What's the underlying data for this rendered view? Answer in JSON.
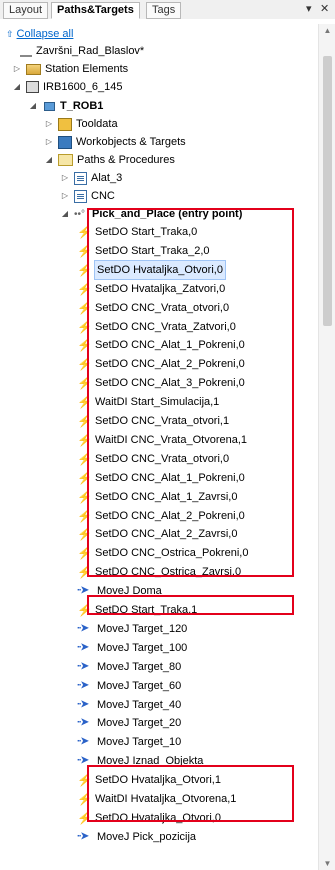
{
  "tabs": [
    "Layout",
    "Paths&Targets",
    "Tags"
  ],
  "tab_controls": {
    "dropdown": "▾",
    "close": "✕"
  },
  "collapse_all": "Collapse all",
  "tree": {
    "station": "Završni_Rad_Blaslov*",
    "station_elements": "Station Elements",
    "robot": "IRB1600_6_145",
    "task": "T_ROB1",
    "tooldata": "Tooldata",
    "workobjects": "Workobjects & Targets",
    "paths_procedures": "Paths & Procedures",
    "module_alat3": "Alat_3",
    "module_cnc": "CNC",
    "procedure": "Pick_and_Place (entry point)"
  },
  "instructions": [
    {
      "text": "SetDO Start_Traka,0",
      "kind": "io"
    },
    {
      "text": "SetDO Start_Traka_2,0",
      "kind": "io"
    },
    {
      "text": "SetDO Hvataljka_Otvori,0",
      "kind": "io",
      "selected": true
    },
    {
      "text": "SetDO Hvataljka_Zatvori,0",
      "kind": "io"
    },
    {
      "text": "SetDO CNC_Vrata_otvori,0",
      "kind": "io"
    },
    {
      "text": "SetDO CNC_Vrata_Zatvori,0",
      "kind": "io"
    },
    {
      "text": "SetDO CNC_Alat_1_Pokreni,0",
      "kind": "io"
    },
    {
      "text": "SetDO CNC_Alat_2_Pokreni,0",
      "kind": "io"
    },
    {
      "text": "SetDO CNC_Alat_3_Pokreni,0",
      "kind": "io"
    },
    {
      "text": "WaitDI Start_Simulacija,1",
      "kind": "io"
    },
    {
      "text": "SetDO CNC_Vrata_otvori,1",
      "kind": "io"
    },
    {
      "text": "WaitDI CNC_Vrata_Otvorena,1",
      "kind": "io"
    },
    {
      "text": "SetDO CNC_Vrata_otvori,0",
      "kind": "io"
    },
    {
      "text": "SetDO CNC_Alat_1_Pokreni,0",
      "kind": "io"
    },
    {
      "text": "SetDO CNC_Alat_1_Zavrsi,0",
      "kind": "io"
    },
    {
      "text": "SetDO CNC_Alat_2_Pokreni,0",
      "kind": "io"
    },
    {
      "text": "SetDO CNC_Alat_2_Zavrsi,0",
      "kind": "io"
    },
    {
      "text": "SetDO CNC_Ostrica_Pokreni,0",
      "kind": "io"
    },
    {
      "text": "SetDO CNC_Ostrica_Zavrsi,0",
      "kind": "io"
    },
    {
      "text": "MoveJ Doma",
      "kind": "move"
    },
    {
      "text": "SetDO Start_Traka,1",
      "kind": "io"
    },
    {
      "text": "MoveJ Target_120",
      "kind": "move"
    },
    {
      "text": "MoveJ Target_100",
      "kind": "move"
    },
    {
      "text": "MoveJ Target_80",
      "kind": "move"
    },
    {
      "text": "MoveJ Target_60",
      "kind": "move"
    },
    {
      "text": "MoveJ Target_40",
      "kind": "move"
    },
    {
      "text": "MoveJ Target_20",
      "kind": "move"
    },
    {
      "text": "MoveJ Target_10",
      "kind": "move"
    },
    {
      "text": "MoveJ Iznad_Objekta",
      "kind": "move"
    },
    {
      "text": "SetDO Hvataljka_Otvori,1",
      "kind": "io"
    },
    {
      "text": "WaitDI Hvataljka_Otvorena,1",
      "kind": "io"
    },
    {
      "text": "SetDO Hvataljka_Otvori,0",
      "kind": "io"
    },
    {
      "text": "MoveJ Pick_pozicija",
      "kind": "move"
    }
  ],
  "colors": {
    "highlight_box": "#e3001b",
    "link": "#0066cc"
  }
}
